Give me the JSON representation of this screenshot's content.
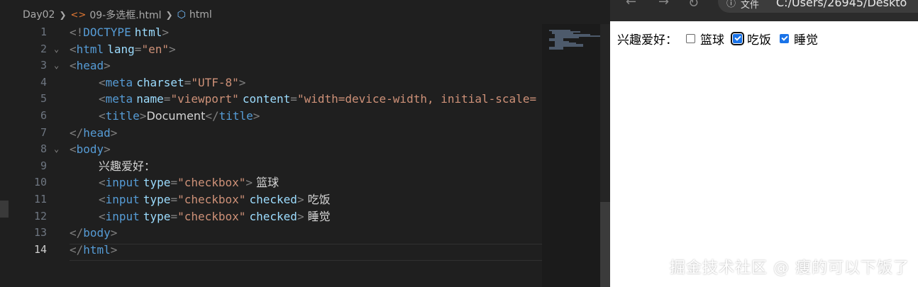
{
  "breadcrumb": {
    "folder": "Day02",
    "file": "09-多选框.html",
    "symbol": "html",
    "separator_icon": "chevron-right-icon",
    "file_icon": "code-brackets-icon",
    "symbol_icon": "cube-icon"
  },
  "editor": {
    "current_line": 14,
    "lines": [
      {
        "n": "1",
        "fold": "",
        "tokens": [
          [
            "t",
            "<!"
          ],
          [
            "tn",
            "DOCTYPE"
          ],
          [
            "tx",
            " "
          ],
          [
            "an",
            "html"
          ],
          [
            "t",
            ">"
          ]
        ]
      },
      {
        "n": "2",
        "fold": "v",
        "tokens": [
          [
            "t",
            "<"
          ],
          [
            "tn",
            "html"
          ],
          [
            "tx",
            " "
          ],
          [
            "an",
            "lang"
          ],
          [
            "t",
            "="
          ],
          [
            "av",
            "\"en\""
          ],
          [
            "t",
            ">"
          ]
        ]
      },
      {
        "n": "3",
        "fold": "v",
        "tokens": [
          [
            "t",
            "<"
          ],
          [
            "tn",
            "head"
          ],
          [
            "t",
            ">"
          ]
        ]
      },
      {
        "n": "4",
        "fold": "",
        "indent": 1,
        "tokens": [
          [
            "t",
            "<"
          ],
          [
            "tn",
            "meta"
          ],
          [
            "tx",
            " "
          ],
          [
            "an",
            "charset"
          ],
          [
            "t",
            "="
          ],
          [
            "av",
            "\"UTF-8\""
          ],
          [
            "t",
            ">"
          ]
        ]
      },
      {
        "n": "5",
        "fold": "",
        "indent": 1,
        "tokens": [
          [
            "t",
            "<"
          ],
          [
            "tn",
            "meta"
          ],
          [
            "tx",
            " "
          ],
          [
            "an",
            "name"
          ],
          [
            "t",
            "="
          ],
          [
            "av",
            "\"viewport\""
          ],
          [
            "tx",
            " "
          ],
          [
            "an",
            "content"
          ],
          [
            "t",
            "="
          ],
          [
            "av",
            "\"width=device-width, initial-scale="
          ]
        ]
      },
      {
        "n": "6",
        "fold": "",
        "indent": 1,
        "tokens": [
          [
            "t",
            "<"
          ],
          [
            "tn",
            "title"
          ],
          [
            "t",
            ">"
          ],
          [
            "tx",
            "Document"
          ],
          [
            "t",
            "</"
          ],
          [
            "tn",
            "title"
          ],
          [
            "t",
            ">"
          ]
        ]
      },
      {
        "n": "7",
        "fold": "",
        "tokens": [
          [
            "t",
            "</"
          ],
          [
            "tn",
            "head"
          ],
          [
            "t",
            ">"
          ]
        ]
      },
      {
        "n": "8",
        "fold": "v",
        "tokens": [
          [
            "t",
            "<"
          ],
          [
            "tn",
            "body"
          ],
          [
            "t",
            ">"
          ]
        ]
      },
      {
        "n": "9",
        "fold": "",
        "indent": 1,
        "tokens": [
          [
            "tx",
            "兴趣爱好："
          ]
        ]
      },
      {
        "n": "10",
        "fold": "",
        "indent": 1,
        "tokens": [
          [
            "t",
            "<"
          ],
          [
            "tn",
            "input"
          ],
          [
            "tx",
            " "
          ],
          [
            "an",
            "type"
          ],
          [
            "t",
            "="
          ],
          [
            "av",
            "\"checkbox\""
          ],
          [
            "t",
            ">"
          ],
          [
            "tx",
            " 篮球"
          ]
        ]
      },
      {
        "n": "11",
        "fold": "",
        "indent": 1,
        "tokens": [
          [
            "t",
            "<"
          ],
          [
            "tn",
            "input"
          ],
          [
            "tx",
            " "
          ],
          [
            "an",
            "type"
          ],
          [
            "t",
            "="
          ],
          [
            "av",
            "\"checkbox\""
          ],
          [
            "tx",
            " "
          ],
          [
            "an",
            "checked"
          ],
          [
            "t",
            ">"
          ],
          [
            "tx",
            " 吃饭"
          ]
        ]
      },
      {
        "n": "12",
        "fold": "",
        "indent": 1,
        "tokens": [
          [
            "t",
            "<"
          ],
          [
            "tn",
            "input"
          ],
          [
            "tx",
            " "
          ],
          [
            "an",
            "type"
          ],
          [
            "t",
            "="
          ],
          [
            "av",
            "\"checkbox\""
          ],
          [
            "tx",
            " "
          ],
          [
            "an",
            "checked"
          ],
          [
            "t",
            ">"
          ],
          [
            "tx",
            " 睡觉"
          ]
        ]
      },
      {
        "n": "13",
        "fold": "",
        "tokens": [
          [
            "t",
            "</"
          ],
          [
            "tn",
            "body"
          ],
          [
            "t",
            ">"
          ]
        ]
      },
      {
        "n": "14",
        "fold": "",
        "tokens": [
          [
            "t",
            "</"
          ],
          [
            "tn",
            "html"
          ],
          [
            "t",
            ">"
          ]
        ]
      }
    ]
  },
  "browser": {
    "address_label": "文件",
    "address_url": "C:/Users/26945/Deskto",
    "nav_icons": [
      "back-arrow-icon",
      "forward-arrow-icon",
      "reload-icon",
      "info-icon"
    ],
    "page": {
      "label": "兴趣爱好：",
      "checkboxes": [
        {
          "label": "篮球",
          "checked": false,
          "focused": false
        },
        {
          "label": "吃饭",
          "checked": true,
          "focused": true
        },
        {
          "label": "睡觉",
          "checked": true,
          "focused": false
        }
      ]
    }
  },
  "watermark": "掘金技术社区 @ 瘦的可以下饭了",
  "colors": {
    "editor_bg": "#1f1f1f",
    "tag": "#569cd6",
    "attr_name": "#9cdcfe",
    "attr_value": "#ce9178",
    "checkbox_accent": "#1a73e8"
  }
}
